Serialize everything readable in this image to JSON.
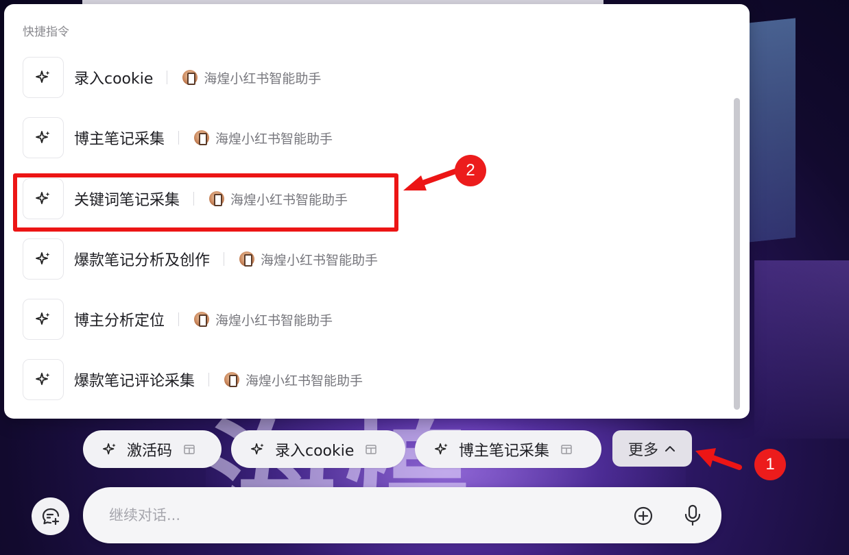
{
  "popup": {
    "title": "快捷指令",
    "commands": [
      {
        "label": "录入cookie",
        "source": "海煌小红书智能助手"
      },
      {
        "label": "博主笔记采集",
        "source": "海煌小红书智能助手"
      },
      {
        "label": "关键词笔记采集",
        "source": "海煌小红书智能助手"
      },
      {
        "label": "爆款笔记分析及创作",
        "source": "海煌小红书智能助手"
      },
      {
        "label": "博主分析定位",
        "source": "海煌小红书智能助手"
      },
      {
        "label": "爆款笔记评论采集",
        "source": "海煌小红书智能助手"
      }
    ],
    "highlighted_index": 2
  },
  "annotations": {
    "step1": "1",
    "step2": "2",
    "color": "#ec1515"
  },
  "chips": [
    {
      "label": "激活码"
    },
    {
      "label": "录入cookie"
    },
    {
      "label": "博主笔记采集"
    }
  ],
  "more_button": {
    "label": "更多"
  },
  "composer": {
    "placeholder": "继续对话..."
  },
  "background": {
    "glyph": "海煌"
  },
  "icons": {
    "command": "sparkle-icon",
    "chip_external": "window-icon",
    "more": "chevron-up-icon",
    "new_chat": "new-chat-icon",
    "attach": "plus-circle-icon",
    "voice": "microphone-icon"
  },
  "colors": {
    "accent": "#ec1515",
    "popup_bg": "#ffffff",
    "chip_bg": "#f2f2f5"
  }
}
